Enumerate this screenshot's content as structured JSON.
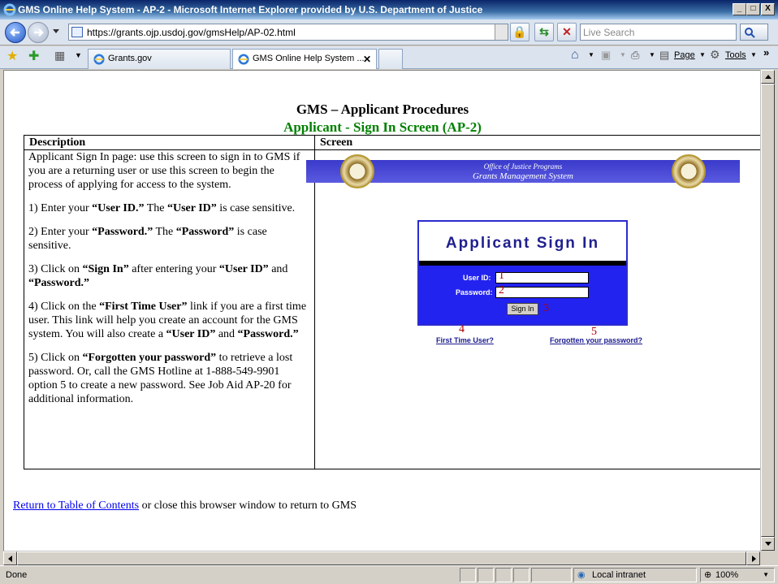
{
  "window": {
    "title": "GMS Online Help System - AP-2 - Microsoft Internet Explorer provided by U.S. Department of Justice",
    "minimize": "_",
    "maximize": "□",
    "close": "X"
  },
  "address": {
    "url": "https://grants.ojp.usdoj.gov/gmsHelp/AP-02.html",
    "search_placeholder": "Live Search"
  },
  "tabs": [
    {
      "label": "Grants.gov"
    },
    {
      "label": "GMS Online Help System ..."
    }
  ],
  "commands": {
    "page": "Page",
    "tools": "Tools",
    "more": "»"
  },
  "document": {
    "heading": "GMS – Applicant Procedures",
    "subheading": "Applicant - Sign In Screen (AP-2)",
    "table": {
      "col_description": "Description",
      "col_screen": "Screen",
      "paragraphs": [
        {
          "pre": "Applicant Sign In page: use this screen to sign in to GMS if you are a returning user or use this screen to begin the process of applying for access to the system."
        },
        {
          "pre": "1) Enter your ",
          "b1": "“User ID.”",
          "mid": "  The ",
          "b2": "“User ID”",
          "post": " is case sensitive."
        },
        {
          "pre": "2) Enter your ",
          "b1": "“Password.”",
          "mid": "  The ",
          "b2": "“Password”",
          "post": " is case sensitive."
        },
        {
          "pre": "3) Click on ",
          "b1": "“Sign In”",
          "mid": " after entering your ",
          "b2": "“User ID”",
          "post": " and ",
          "b3": "“Password.”"
        },
        {
          "pre": "4) Click on the ",
          "b1": "“First Time User”",
          "mid": " link if you are a first time user.  This link will help you create an account  for the GMS system. You will also create a ",
          "b2": "“User ID”",
          "post": " and ",
          "b3": "“Password.”"
        },
        {
          "pre": "5) Click on ",
          "b1": "“Forgotten your password”",
          "mid": " to retrieve a lost password. Or, call the GMS Hotline at 1-888-549-9901 option 5 to create a new password.  See Job Aid AP-20 for additional information."
        }
      ]
    },
    "screenshot": {
      "banner_line1": "Office of Justice Programs",
      "banner_line2": "Grants Management System",
      "login_title": "Applicant Sign In",
      "user_id_label": "User  ID:",
      "password_label": "Password:",
      "sign_in_button": "Sign In",
      "first_time_link": "First Time User?",
      "forgot_link": "Forgotten your password?",
      "callouts": [
        "1",
        "2",
        "3",
        "4",
        "5"
      ]
    },
    "footer": {
      "link": "Return to Table of Contents",
      "text": " or close this browser window to return to GMS"
    }
  },
  "status": {
    "left": "Done",
    "zone": "Local intranet",
    "zoom": "100%"
  }
}
